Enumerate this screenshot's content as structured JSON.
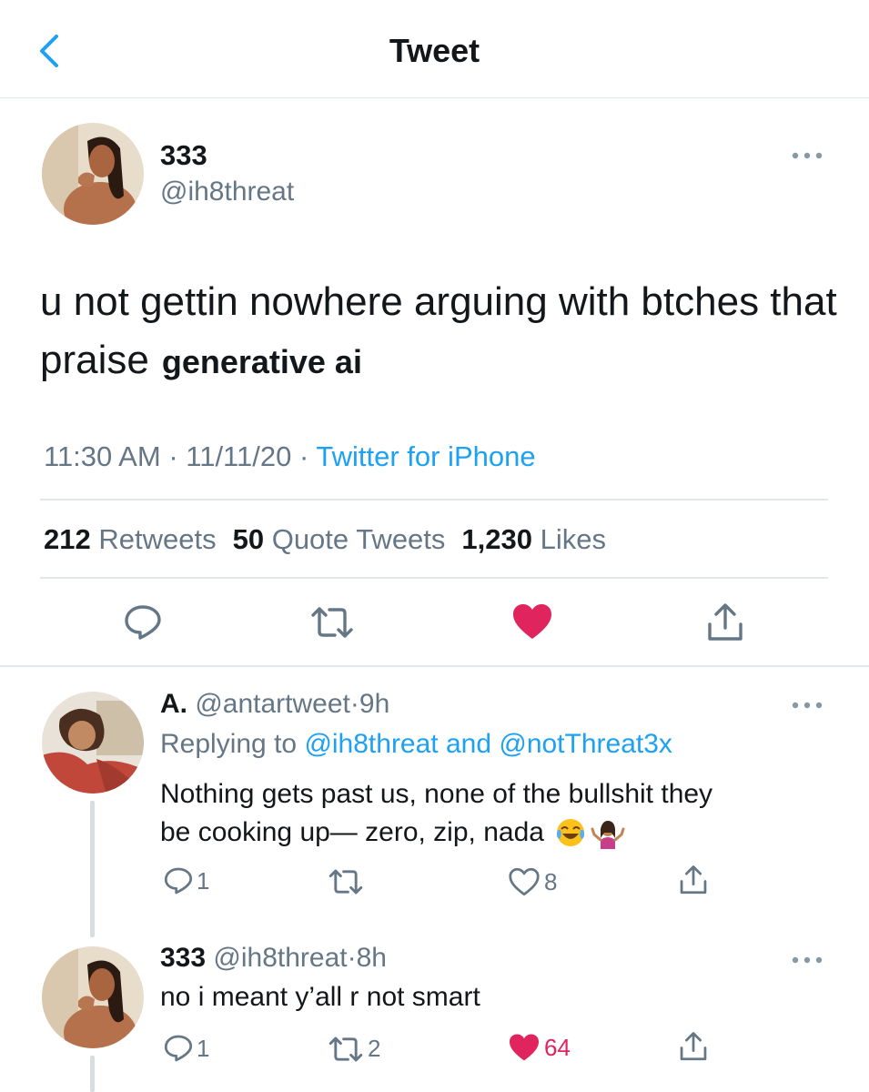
{
  "header": {
    "title": "Tweet",
    "back_icon": "chevron-left-icon"
  },
  "main_tweet": {
    "name": "333",
    "handle": "@ih8threat",
    "text": "u not gettin nowhere arguing with btches that praise",
    "text_overlay": "generative ai",
    "time": "11:30 AM",
    "date": "11/11/20",
    "source": "Twitter for iPhone",
    "stats": {
      "retweets_count": "212",
      "retweets_label": "Retweets",
      "quotes_count": "50",
      "quotes_label": "Quote Tweets",
      "likes_count": "1,230",
      "likes_label": "Likes"
    },
    "liked": true
  },
  "replies": [
    {
      "name": "A.",
      "handle": "@antartweet",
      "time": "9h",
      "replying_prefix": "Replying to",
      "replying_users": "@ih8threat and @notThreat3x",
      "text_line1": "Nothing gets past us, none of the bullshit they",
      "text_line2": "be cooking up— zero, zip, nada",
      "emojis": [
        "tears-of-joy-emoji",
        "person-shrugging-emoji"
      ],
      "reply_count": "1",
      "retweet_count": "",
      "like_count": "8",
      "liked": false
    },
    {
      "name": "333",
      "handle": "@ih8threat",
      "time": "8h",
      "text": "no i meant y’all r not smart",
      "reply_count": "1",
      "retweet_count": "2",
      "like_count": "64",
      "liked": true
    }
  ],
  "colors": {
    "accent": "#1da1f2",
    "like": "#e0245e",
    "text": "#14171a",
    "secondary": "#657786",
    "divider": "#e1e8ed"
  },
  "separators": {
    "dot": "·"
  }
}
